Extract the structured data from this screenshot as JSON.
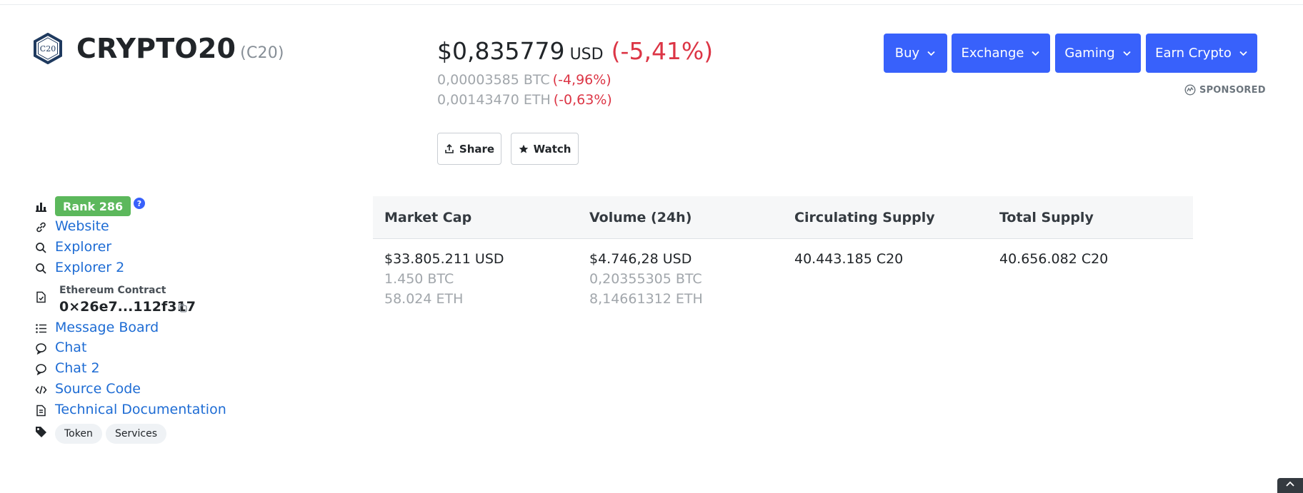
{
  "coin": {
    "logo_text": "C20",
    "name": "CRYPTO20",
    "symbol": "(C20)"
  },
  "price": {
    "usd_value": "$0,835779",
    "usd_unit": "USD",
    "usd_change": "(-5,41%)",
    "btc_value": "0,00003585 BTC",
    "btc_change": "(-4,96%)",
    "eth_value": "0,00143470 ETH",
    "eth_change": "(-0,63%)"
  },
  "actions": {
    "share_label": "Share",
    "watch_label": "Watch"
  },
  "top_buttons": [
    {
      "label": "Buy"
    },
    {
      "label": "Exchange"
    },
    {
      "label": "Gaming"
    },
    {
      "label": "Earn Crypto"
    }
  ],
  "sponsored_label": "SPONSORED",
  "sidebar": {
    "rank": "Rank 286",
    "help": "?",
    "links": {
      "website": "Website",
      "explorer": "Explorer",
      "explorer2": "Explorer 2",
      "message_board": "Message Board",
      "chat": "Chat",
      "chat2": "Chat 2",
      "source_code": "Source Code",
      "tech_docs": "Technical Documentation"
    },
    "contract": {
      "label": "Ethereum Contract",
      "address": "0×26e7...112f317"
    },
    "tags": [
      "Token",
      "Services"
    ]
  },
  "stats": {
    "headers": [
      "Market Cap",
      "Volume (24h)",
      "Circulating Supply",
      "Total Supply"
    ],
    "market_cap": {
      "usd": "$33.805.211 USD",
      "btc": "1.450 BTC",
      "eth": "58.024 ETH"
    },
    "volume": {
      "usd": "$4.746,28 USD",
      "btc": "0,20355305 BTC",
      "eth": "8,14661312 ETH"
    },
    "circulating": {
      "value": "40.443.185 C20"
    },
    "total": {
      "value": "40.656.082 C20"
    }
  },
  "colors": {
    "accent": "#3861fb",
    "negative": "#dc3545",
    "link": "#1e6cd4",
    "rank_badge": "#5cb85c"
  }
}
